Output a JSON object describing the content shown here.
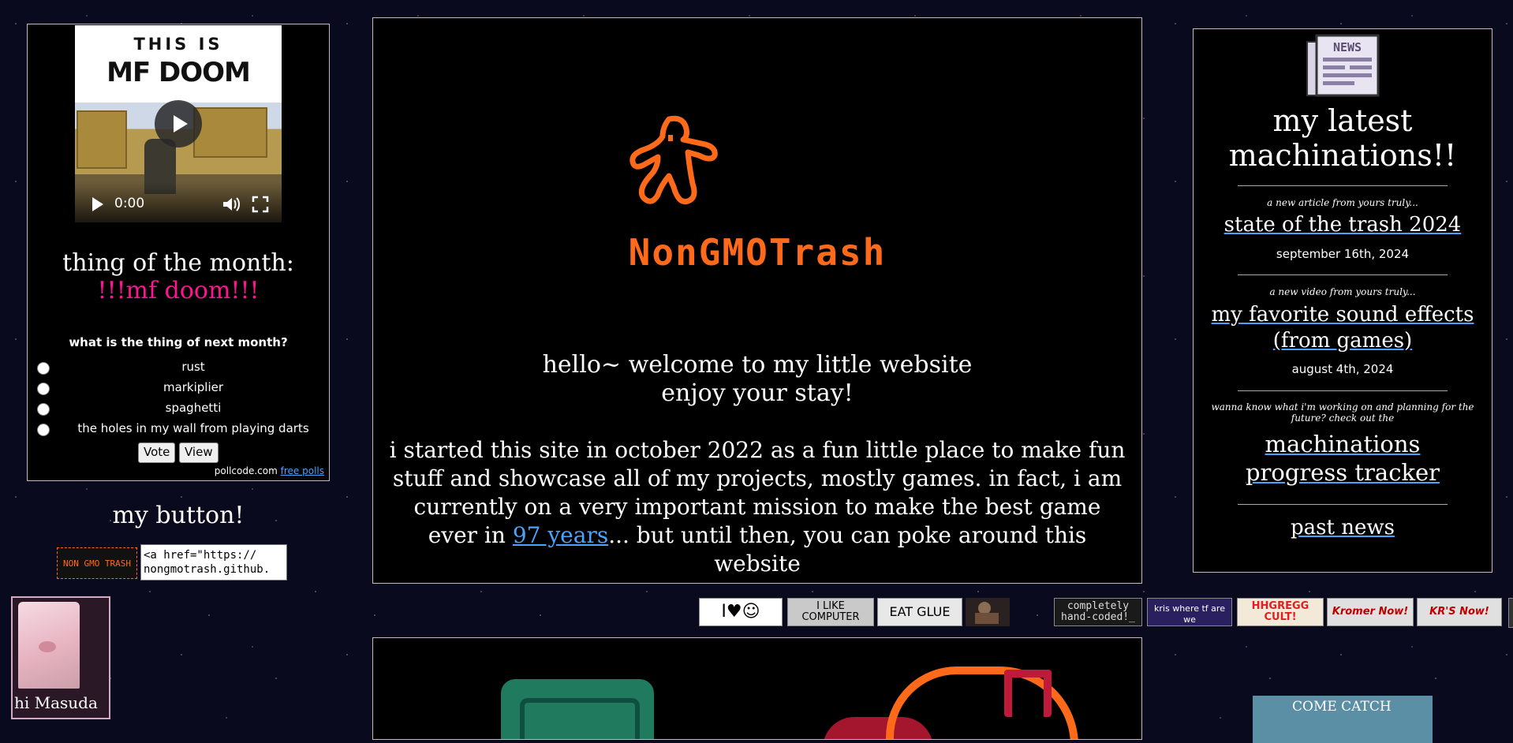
{
  "left": {
    "video": {
      "thumb_line1": "THIS IS",
      "thumb_line2": "MF DOOM",
      "time": "0:00"
    },
    "thing_title": "thing of the month:",
    "thing_name": "!!!mf doom!!!",
    "poll": {
      "question": "what is the thing of next month?",
      "options": [
        "rust",
        "markiplier",
        "spaghetti",
        "the holes in my wall from playing darts"
      ],
      "vote_label": "Vote",
      "view_label": "View",
      "credit": "pollcode.com",
      "credit_link": "free polls"
    },
    "my_button_title": "my button!",
    "my_button_art": "NON GMO TRASH",
    "button_code": "<a href=\"https://\nnongmotrash.github.",
    "cat_label": "hi Masuda"
  },
  "center": {
    "logo_text": "NonGMOTrash",
    "welcome_line1": "hello~ welcome to my little website",
    "welcome_line2": "enjoy your stay!",
    "intro_before": "i started this site in october 2022 as a fun little place to make fun stuff and showcase all of my projects, mostly games. in fact, i am currently on a very important mission to make the best game ever in ",
    "intro_link": "97 years",
    "intro_after": "... but until then, you can poke around this website"
  },
  "buttons88": [
    {
      "label": "I♥☺",
      "name": "i-love-undertale-button"
    },
    {
      "label": "I LIKE COMPUTER",
      "name": "i-like-computer-button"
    },
    {
      "label": "EAT GLUE",
      "name": "eat-glue-button"
    },
    {
      "label": "",
      "name": "armored-figure-button"
    },
    {
      "label": "completely hand-coded!_",
      "name": "hand-coded-button"
    },
    {
      "label": "kris where tf are we",
      "name": "kris-where-button"
    },
    {
      "label": "HHGREGG CULT!",
      "name": "hhgregg-cult-button"
    },
    {
      "label": "Kromer Now!",
      "name": "kromer-now-button"
    },
    {
      "label": "KR'S Now!",
      "name": "krs-now-button"
    }
  ],
  "right": {
    "news_icon_label": "NEWS",
    "latest_title": "my latest machinations!!",
    "article_kicker": "a new article from yours truly...",
    "article_title": "state of the trash 2024",
    "article_date": "september 16th, 2024",
    "video_kicker": "a new video from yours truly...",
    "video_title": "my favorite sound effects (from games)",
    "video_date": "august 4th, 2024",
    "future_text": "wanna know what i'm working on and planning for the future? check out the",
    "tracker_link": "machinations progress tracker",
    "past_news_link": "past news",
    "come_catch": "COME CATCH"
  },
  "colors": {
    "accent_orange": "#ff6a1a",
    "link_blue": "#4aa3ff",
    "pink": "#ff1493",
    "panel_border": "#c9b6c4"
  }
}
